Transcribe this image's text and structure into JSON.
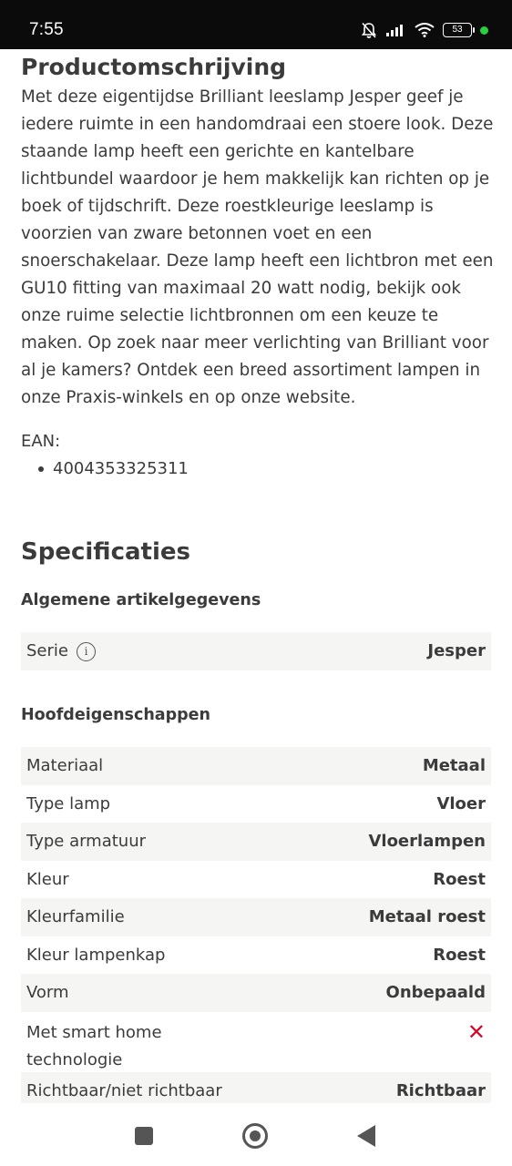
{
  "status_bar": {
    "time": "7:55",
    "battery": "53",
    "icons": [
      "bell-off-icon",
      "signal-icon",
      "wifi-icon",
      "battery-icon",
      "notification-dot-icon"
    ]
  },
  "description": {
    "heading": "Productomschrijving",
    "text": "Met deze eigentijdse Brilliant leeslamp Jesper geef je iedere ruimte in een handomdraai een stoere look. Deze staande lamp heeft een gerichte en kantelbare lichtbundel waardoor je hem makkelijk kan richten op je boek of tijdschrift. Deze roestkleurige leeslamp is voorzien van zware betonnen voet en een snoerschakelaar. Deze lamp heeft een lichtbron met een GU10 fitting van maximaal 20 watt nodig, bekijk ook onze ruime selectie lichtbronnen om een keuze te maken. Op zoek naar meer verlichting van Brilliant voor al je kamers? Ontdek een breed assortiment lampen in onze Praxis-winkels en op onze website.",
    "ean_label": "EAN:",
    "ean_values": [
      "4004353325311"
    ]
  },
  "specs": {
    "heading": "Specificaties",
    "groups": [
      {
        "title": "Algemene artikelgegevens",
        "rows": [
          {
            "label": "Serie",
            "value": "Jesper",
            "info": "i"
          }
        ]
      },
      {
        "title": "Hoofdeigenschappen",
        "rows": [
          {
            "label": "Materiaal",
            "value": "Metaal"
          },
          {
            "label": "Type lamp",
            "value": "Vloer"
          },
          {
            "label": "Type armatuur",
            "value": "Vloerlampen"
          },
          {
            "label": "Kleur",
            "value": "Roest"
          },
          {
            "label": "Kleurfamilie",
            "value": "Metaal roest"
          },
          {
            "label": "Kleur lampenkap",
            "value": "Roest"
          },
          {
            "label": "Vorm",
            "value": "Onbepaald"
          },
          {
            "label": "Met smart home technologie",
            "value": "✕"
          },
          {
            "label": "Richtbaar/niet richtbaar",
            "value": "Richtbaar"
          }
        ]
      }
    ]
  },
  "nav_bar": {
    "icons": [
      "recent-apps-icon",
      "home-icon",
      "back-icon"
    ]
  },
  "colors": {
    "cross": "#c8102e",
    "row_shade": "#f5f5f3",
    "text": "#3b3b3b"
  }
}
